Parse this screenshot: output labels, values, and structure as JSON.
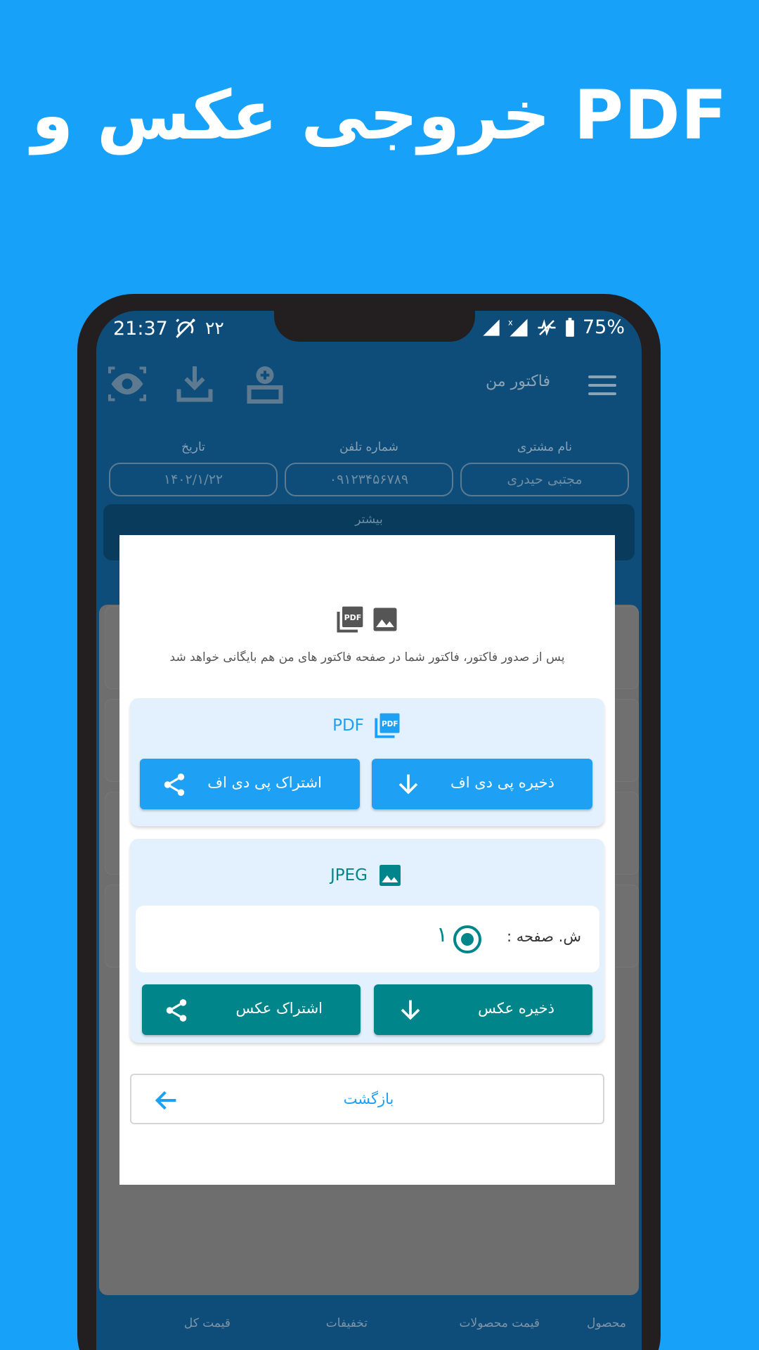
{
  "headline": "خروجی عکس و PDF",
  "status_bar": {
    "time": "21:37",
    "notif_count": "۲۲",
    "battery": "75%"
  },
  "toolbar": {
    "title": "فاکتور من"
  },
  "form": {
    "customer_label": "نام مشتری",
    "customer_value": "مجتبی حیدری",
    "phone_label": "شماره تلفن",
    "phone_value": "۰۹۱۲۳۴۵۶۷۸۹",
    "date_label": "تاریخ",
    "date_value": "۱۴۰۲/۱/۲۲",
    "more_label": "بیشتر"
  },
  "bottom_columns": [
    "محصول",
    "قیمت محصولات",
    "تخفیفات",
    "قیمت کل"
  ],
  "dialog": {
    "description": "پس از صدور فاکتور، فاکتور شما در صفحه فاکتور های من هم بایگانی خواهد شد",
    "pdf": {
      "title": "PDF",
      "save_label": "ذخیره پی دی اف",
      "share_label": "اشتراک پی دی اف"
    },
    "jpeg": {
      "title": "JPEG",
      "page_label": "ش. صفحه :",
      "page_value": "۱",
      "save_label": "ذخیره عکس",
      "share_label": "اشتراک عکس"
    },
    "back_label": "بازگشت"
  },
  "colors": {
    "background": "#17A1F8",
    "blue_button": "#1EA0F4",
    "teal_button": "#00868A",
    "section_bg": "#E2F1FD"
  }
}
